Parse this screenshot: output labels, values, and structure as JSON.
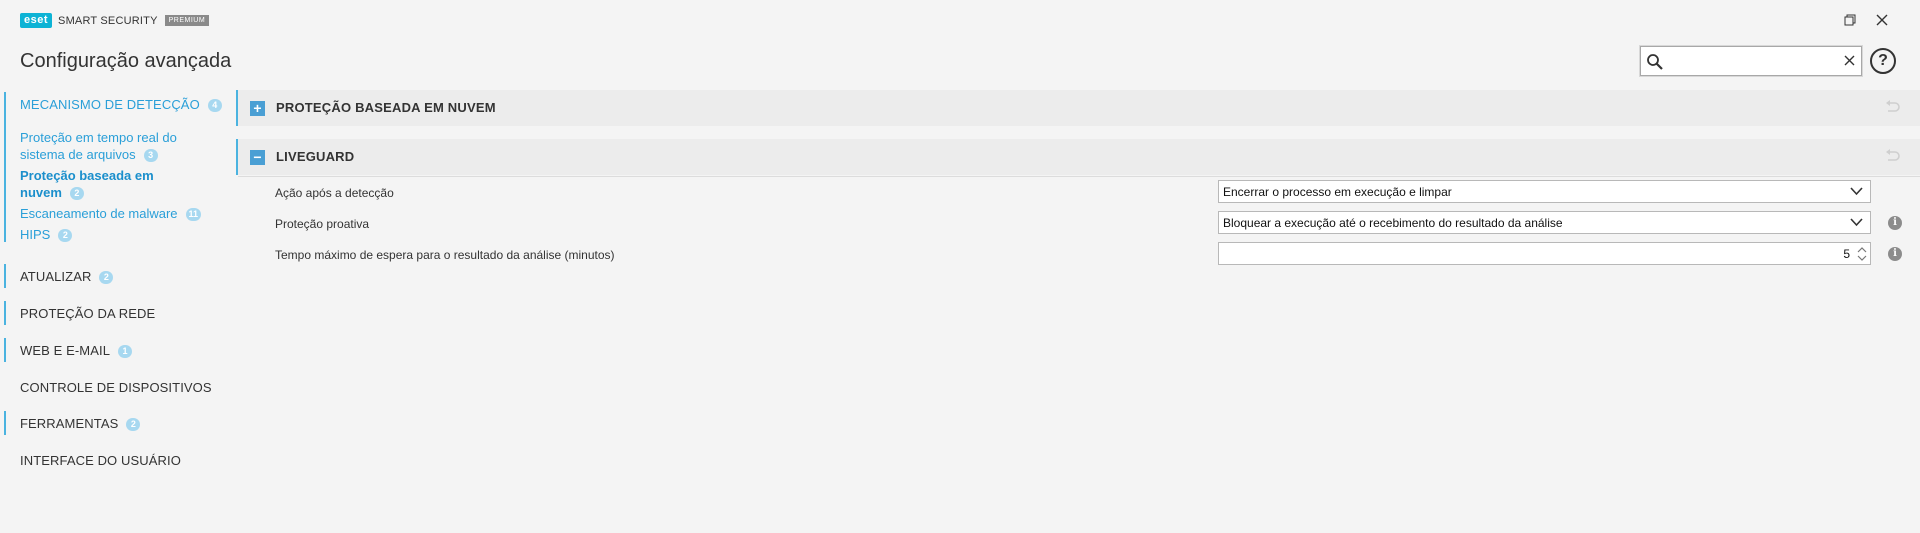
{
  "app": {
    "logo": "eset",
    "product": "SMART SECURITY",
    "edition": "PREMIUM"
  },
  "window": {
    "restore_icon": "restore-window-icon",
    "close_icon": "close-icon"
  },
  "header": {
    "title": "Configuração avançada",
    "search": {
      "value": "",
      "placeholder": ""
    },
    "help": "?"
  },
  "sidebar": {
    "categories": [
      {
        "label": "MECANISMO DE DETECÇÃO",
        "badge": "4"
      },
      {
        "label": "ATUALIZAR",
        "badge": "2"
      },
      {
        "label": "PROTEÇÃO DA REDE",
        "badge": ""
      },
      {
        "label": "WEB E E-MAIL",
        "badge": "1"
      },
      {
        "label": "CONTROLE DE DISPOSITIVOS",
        "badge": ""
      },
      {
        "label": "FERRAMENTAS",
        "badge": "2"
      },
      {
        "label": "INTERFACE DO USUÁRIO",
        "badge": ""
      }
    ],
    "subitems": [
      {
        "line1": "Proteção em tempo real do",
        "line2": "sistema de arquivos",
        "badge": "3"
      },
      {
        "line1": "Proteção baseada em",
        "line2": "nuvem",
        "badge": "2"
      },
      {
        "line1": "Escaneamento de malware",
        "badge": "11"
      },
      {
        "line1": "HIPS",
        "badge": "2"
      }
    ]
  },
  "main": {
    "sections": [
      {
        "title": "PROTEÇÃO BASEADA EM NUVEM",
        "toggle": "+"
      },
      {
        "title": "LIVEGUARD",
        "toggle": "−"
      }
    ],
    "rows": [
      {
        "label": "Ação após a detecção",
        "value": "Encerrar o processo em execução e limpar"
      },
      {
        "label": "Proteção proativa",
        "value": "Bloquear a execução até o recebimento do resultado da análise"
      },
      {
        "label": "Tempo máximo de espera para o resultado da análise (minutos)",
        "value": "5"
      }
    ],
    "info_icon": "i"
  },
  "colors": {
    "accent": "#2a9fd8",
    "background": "#f4f4f4",
    "section_bg": "#ececec",
    "badge": "#a7d8f0",
    "logo": "#0db3d5"
  }
}
